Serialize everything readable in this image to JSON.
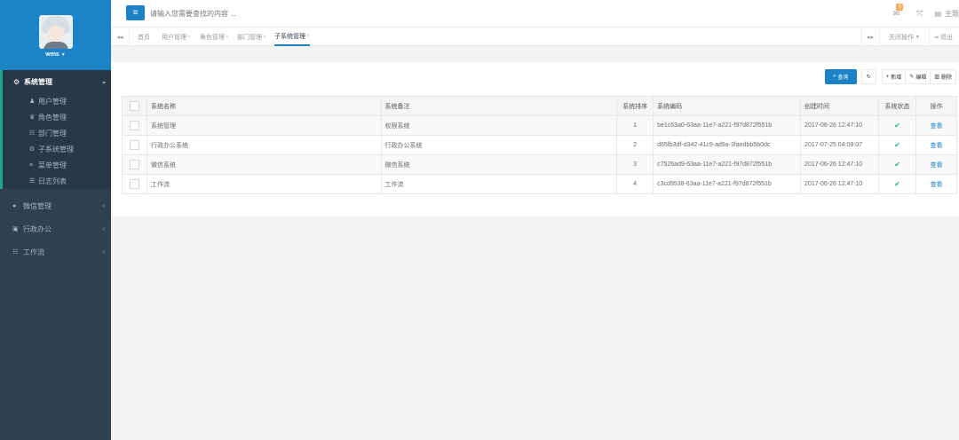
{
  "sidebar": {
    "username": "wms",
    "active_menu": {
      "label": "系统管理",
      "children": [
        {
          "label": "用户管理",
          "icon": "user-icon",
          "glyph": "♟"
        },
        {
          "label": "角色管理",
          "icon": "users-icon",
          "glyph": "♛"
        },
        {
          "label": "部门管理",
          "icon": "sitemap-icon",
          "glyph": "☷"
        },
        {
          "label": "子系统管理",
          "icon": "gear-icon",
          "glyph": "⚙"
        },
        {
          "label": "菜单管理",
          "icon": "list-icon",
          "glyph": "≡"
        },
        {
          "label": "日志列表",
          "icon": "log-icon",
          "glyph": "☰"
        }
      ]
    },
    "menus": [
      {
        "label": "微信管理",
        "icon": "wechat-icon",
        "glyph": "●"
      },
      {
        "label": "行政办公",
        "icon": "book-icon",
        "glyph": "▣"
      },
      {
        "label": "工作流",
        "icon": "sitemap-icon",
        "glyph": "☷"
      }
    ]
  },
  "topbar": {
    "search_placeholder": "请输入您需要查找的内容 ...",
    "mail_badge": "8",
    "theme_label": "主题"
  },
  "tabs": {
    "home": "首页",
    "items": [
      "用户管理",
      "角色管理",
      "部门管理",
      "子系统管理"
    ],
    "close_ops": "关闭操作",
    "logout": "退出"
  },
  "toolbar": {
    "query": "查询",
    "add": "新增",
    "edit": "编辑",
    "delete": "删除"
  },
  "table": {
    "headers": [
      "系统名称",
      "系统备注",
      "系统排序",
      "系统编码",
      "创建时间",
      "系统状态",
      "操作"
    ],
    "rows": [
      {
        "name": "系统管理",
        "remark": "权限系统",
        "order": "1",
        "code": "be1c63a0-63aa-11e7-a221-f97d872f551b",
        "created": "2017-06-26 12:47:10",
        "action": "查看"
      },
      {
        "name": "行政办公系统",
        "remark": "行政办公系统",
        "order": "2",
        "code": "d65fb3df-d342-41c9-ad9a-3faedbb5b0dc",
        "created": "2017-07-25 04:09:07",
        "action": "查看"
      },
      {
        "name": "微信系统",
        "remark": "微信系统",
        "order": "3",
        "code": "c7526ad9-63aa-11e7-a221-f97d872f551b",
        "created": "2017-06-26 12:47:10",
        "action": "查看"
      },
      {
        "name": "工作流",
        "remark": "工作流",
        "order": "4",
        "code": "c3cd9538-63aa-11e7-a221-f97d872f551b",
        "created": "2017-06-26 12:47:10",
        "action": "查看"
      }
    ]
  },
  "colors": {
    "sidebar_bg": "#2f4050",
    "profile_bg": "#1c84c6",
    "primary": "#1c84c6",
    "success": "#1ab394",
    "badge": "#f8ac59"
  }
}
